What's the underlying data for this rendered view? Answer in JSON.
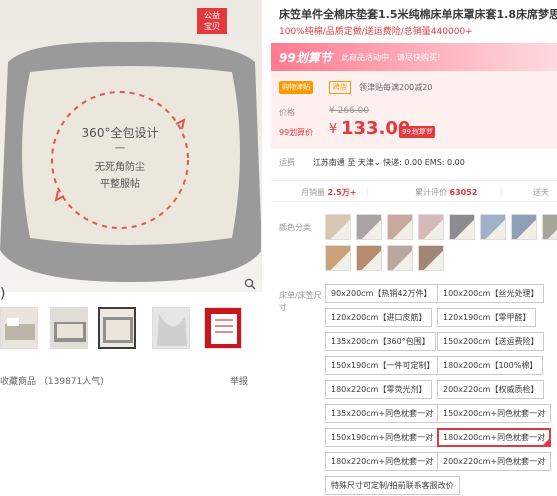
{
  "gallery": {
    "badge": [
      "公益",
      "宝贝"
    ],
    "image_text": {
      "line1": "360°全包设计",
      "line2": "一",
      "line3": "无死角防尘",
      "line4": "平整服帖"
    },
    "prev_arrow": ")",
    "favorite_label": "收藏商品",
    "favorite_count": "（139871人气）",
    "report_label": "举报"
  },
  "product": {
    "title": "床笠单件全棉床垫套1.5米纯棉床单床罩床套1.8床席梦思保",
    "subtitle": "100%纯棉/品质定做/送运费险/总销量440000+"
  },
  "promo": {
    "logo": "99划算节",
    "text": "此商品活动中，请尽快购买！"
  },
  "price": {
    "mall_tag": "购物津贴",
    "mall_tag2": "跨店",
    "coupon_text": "领津贴每满200减20",
    "price_label": "价格",
    "original": "¥ 266.00",
    "sale_label": "99划算价",
    "currency": "¥",
    "sale": "133.00",
    "sale_tag": "99划算节"
  },
  "shipping": {
    "label": "运费",
    "from": "江苏南通",
    "to_label": "至",
    "to": "天津",
    "detail": "快递: 0.00 EMS: 0.00"
  },
  "stats": {
    "monthly_label": "月销量",
    "monthly_value": "2.5万+",
    "reviews_label": "累计评价",
    "reviews_value": "63052",
    "points_label": "送天"
  },
  "sku": {
    "color_label": "颜色分类",
    "size_label": "床单/床笠尺寸",
    "colors": [
      "#d8c7b3",
      "#a9a3a3",
      "#c9a99a",
      "#d7b9ba",
      "#8a8c90",
      "#9fb2c9",
      "#8e9fb6",
      "#a4a69a",
      "#7a6a5a",
      "#c9a27c",
      "#b78c6e",
      "#bba7a0",
      "#a08572"
    ],
    "options": [
      "90x200cm【热销42万件】",
      "100x200cm【丝光处理】",
      "120x200cm【进口皮筋】",
      "120x190cm【零甲醛】",
      "135x200cm【360°包围】",
      "150x200cm【送运费险】",
      "150x190cm【一件可定制】",
      "180x200cm【100%棉】",
      "180x220cm【零荧光剂】",
      "200x220cm【权威质检】",
      "135x200cm+同色枕套一对",
      "150x200cm+同色枕套一对",
      "150x190cm+同色枕套一对",
      "180x200cm+同色枕套一对",
      "180x220cm+同色枕套一对",
      "200x220cm+同色枕套一对",
      "特殊尺寸可定制/拍前联系客服改价"
    ],
    "selected_index": 13
  }
}
